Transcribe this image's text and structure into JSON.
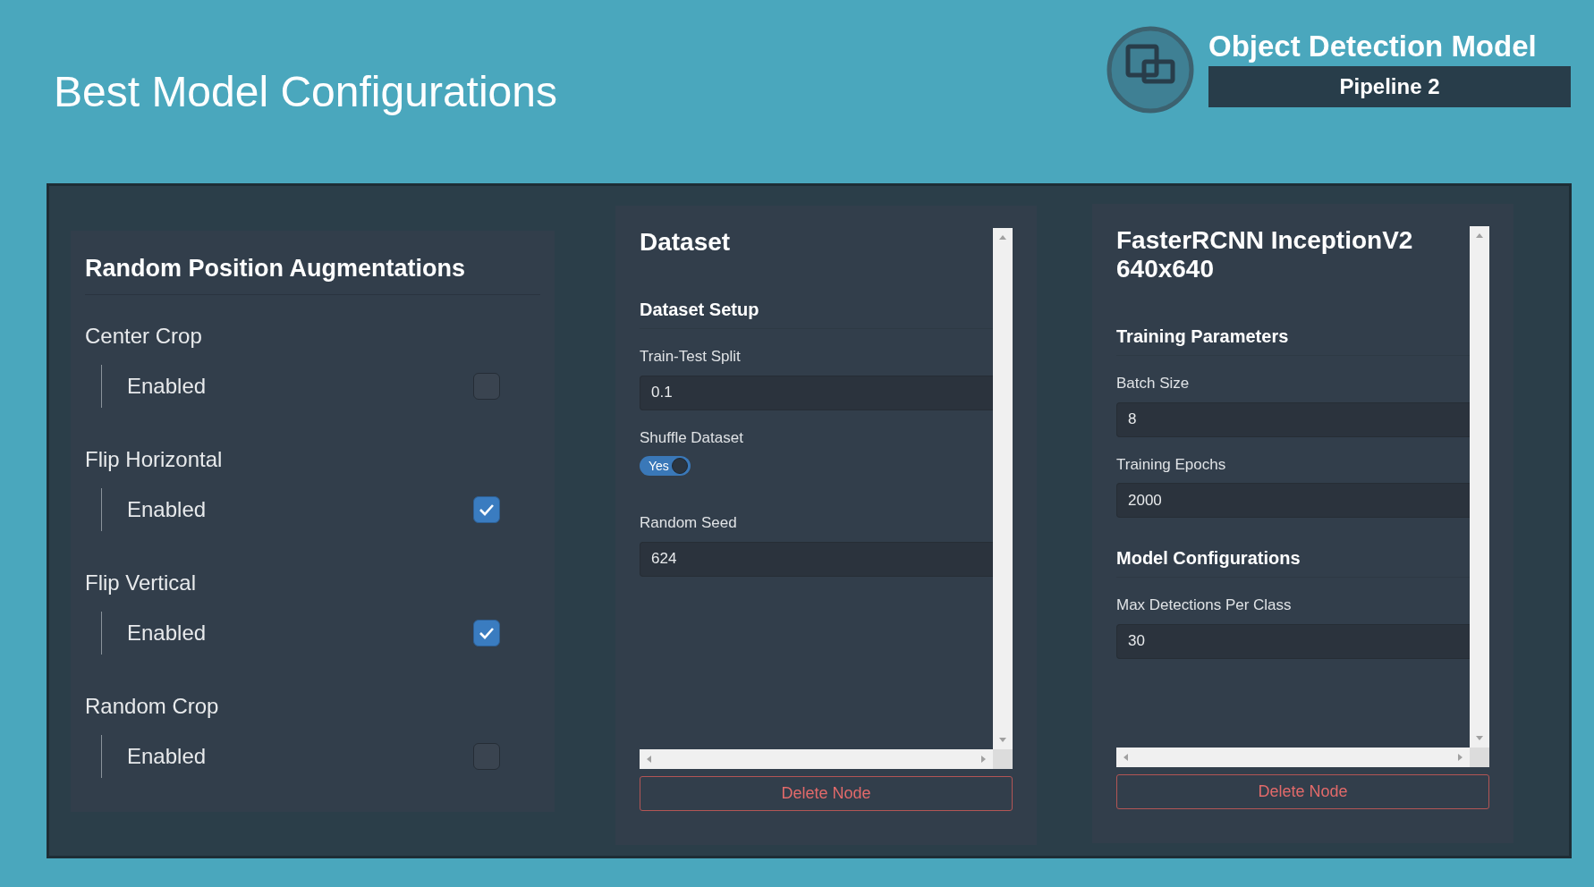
{
  "page_title": "Best Model Configurations",
  "header": {
    "title": "Object Detection Model",
    "subtitle": "Pipeline 2"
  },
  "augmentations": {
    "title": "Random Position Augmentations",
    "groups": [
      {
        "label": "Center Crop",
        "option": {
          "label": "Enabled",
          "checked": false
        }
      },
      {
        "label": "Flip Horizontal",
        "option": {
          "label": "Enabled",
          "checked": true
        }
      },
      {
        "label": "Flip Vertical",
        "option": {
          "label": "Enabled",
          "checked": true
        }
      },
      {
        "label": "Random Crop",
        "option": {
          "label": "Enabled",
          "checked": false
        }
      }
    ]
  },
  "nodes": [
    {
      "title": "Dataset",
      "sections": [
        {
          "heading": "Dataset Setup",
          "fields": [
            {
              "kind": "text",
              "label": "Train-Test Split",
              "value": "0.1"
            },
            {
              "kind": "toggle",
              "label": "Shuffle Dataset",
              "on": true,
              "text": "Yes"
            },
            {
              "kind": "text",
              "label": "Random Seed",
              "value": "624"
            }
          ]
        }
      ],
      "delete_label": "Delete Node"
    },
    {
      "title": "FasterRCNN InceptionV2 640x640",
      "sections": [
        {
          "heading": "Training Parameters",
          "fields": [
            {
              "kind": "text",
              "label": "Batch Size",
              "value": "8"
            },
            {
              "kind": "text",
              "label": "Training Epochs",
              "value": "2000"
            }
          ]
        },
        {
          "heading": "Model Configurations",
          "fields": [
            {
              "kind": "text",
              "label": "Max Detections Per Class",
              "value": "30"
            }
          ]
        }
      ],
      "delete_label": "Delete Node"
    }
  ]
}
